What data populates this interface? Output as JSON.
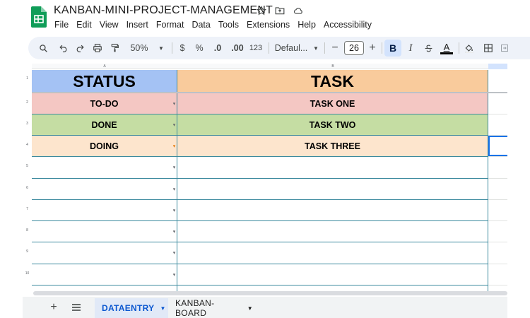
{
  "document": {
    "title": "KANBAN-MINI-PROJECT-MANAGEMENT"
  },
  "menu": [
    "File",
    "Edit",
    "View",
    "Insert",
    "Format",
    "Data",
    "Tools",
    "Extensions",
    "Help",
    "Accessibility"
  ],
  "toolbar": {
    "zoom": "50%",
    "currency": "$",
    "percent": "%",
    "decrease_decimal": ".0",
    "increase_decimal": ".00",
    "number_format": "123",
    "font": "Defaul...",
    "font_size": "26",
    "minus": "−",
    "plus": "+",
    "bold": "B",
    "italic": "I",
    "text_color_letter": "A",
    "text_color_bar": "#000000"
  },
  "grid": {
    "column_letters": [
      "A",
      "B"
    ],
    "row_numbers": [
      "1",
      "2",
      "3",
      "4",
      "5",
      "6",
      "7",
      "8",
      "9",
      "10"
    ],
    "header": {
      "col_a": "STATUS",
      "col_b": "TASK",
      "col_a_color": "#a4c2f4",
      "col_b_color": "#f9cb9c"
    },
    "rows": [
      {
        "status": "TO-DO",
        "task": "TASK ONE",
        "color": "#f4c7c3"
      },
      {
        "status": "DONE",
        "task": "TASK TWO",
        "color": "#c5dda3"
      },
      {
        "status": "DOING",
        "task": "TASK THREE",
        "color": "#fde5cd"
      }
    ]
  },
  "sheets": {
    "active": "DATAENTRY",
    "other": "KANBAN-BOARD"
  }
}
